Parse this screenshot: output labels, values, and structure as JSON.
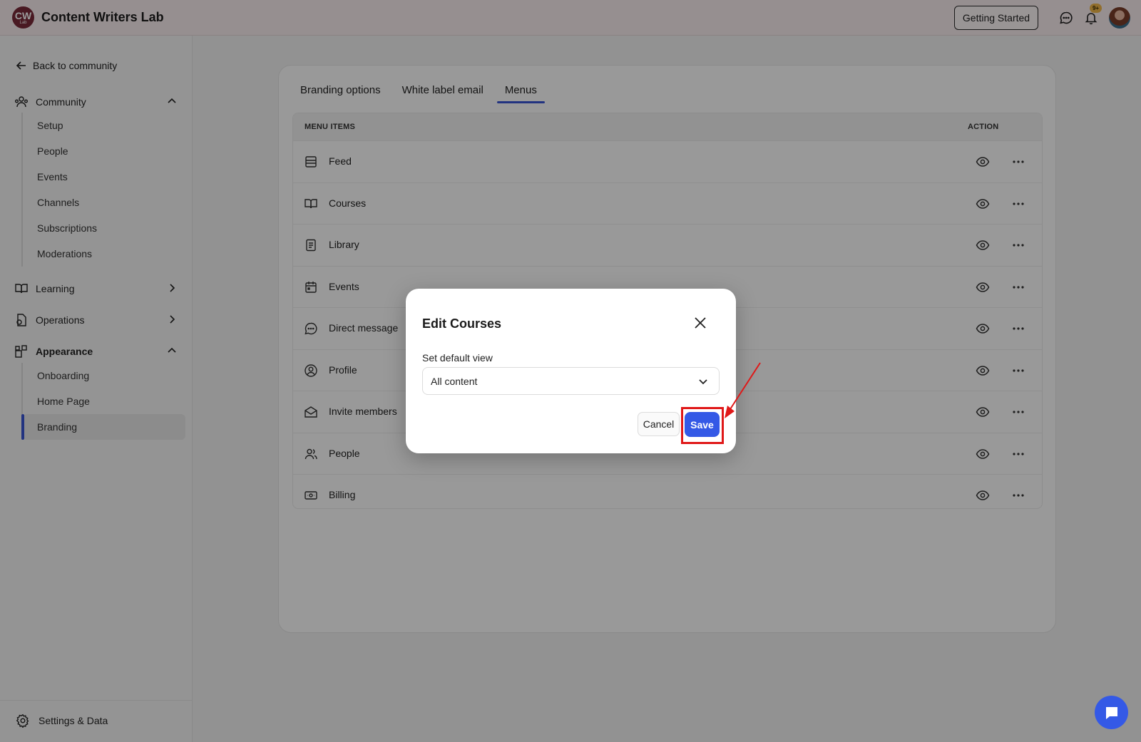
{
  "header": {
    "logo_line1": "CW",
    "logo_line2": "Lab",
    "app_title": "Content Writers Lab",
    "getting_started": "Getting Started",
    "notification_badge": "9+"
  },
  "sidebar": {
    "back_label": "Back to community",
    "community": {
      "label": "Community",
      "items": [
        "Setup",
        "People",
        "Events",
        "Channels",
        "Subscriptions",
        "Moderations"
      ]
    },
    "learning": {
      "label": "Learning"
    },
    "operations": {
      "label": "Operations"
    },
    "appearance": {
      "label": "Appearance",
      "items": [
        "Onboarding",
        "Home Page",
        "Branding"
      ],
      "active": "Branding"
    },
    "settings_label": "Settings & Data"
  },
  "main": {
    "tabs": [
      "Branding options",
      "White label email",
      "Menus"
    ],
    "active_tab": "Menus",
    "table": {
      "col_menu_items": "MENU ITEMS",
      "col_action": "ACTION",
      "rows": [
        {
          "label": "Feed",
          "icon": "feed-icon"
        },
        {
          "label": "Courses",
          "icon": "book-open-icon"
        },
        {
          "label": "Library",
          "icon": "library-icon"
        },
        {
          "label": "Events",
          "icon": "calendar-icon"
        },
        {
          "label": "Direct message",
          "icon": "chat-bubble-icon"
        },
        {
          "label": "Profile",
          "icon": "user-circle-icon"
        },
        {
          "label": "Invite members",
          "icon": "envelope-open-icon"
        },
        {
          "label": "People",
          "icon": "users-icon"
        },
        {
          "label": "Billing",
          "icon": "money-icon"
        }
      ]
    }
  },
  "modal": {
    "title": "Edit Courses",
    "field_label": "Set default view",
    "select_value": "All content",
    "cancel_label": "Cancel",
    "save_label": "Save"
  },
  "colors": {
    "accent": "#3459e6",
    "highlight": "#e01818",
    "topbar": "#fbeef0"
  }
}
